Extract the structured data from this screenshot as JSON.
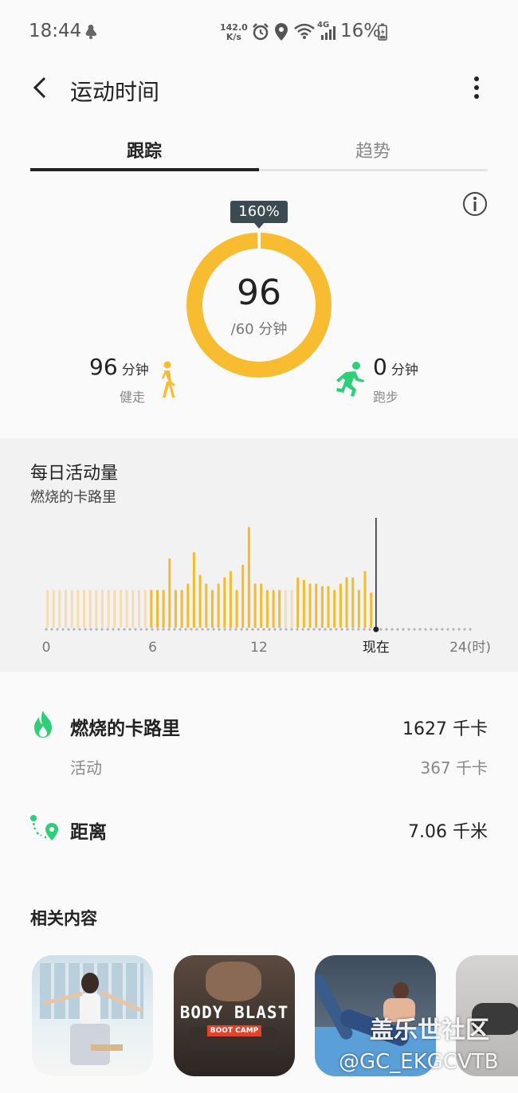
{
  "status_bar": {
    "time": "18:44",
    "net_speed_value": "142.0",
    "net_speed_unit": "K/s",
    "network_type": "4G",
    "battery": "16%"
  },
  "app_bar": {
    "title": "运动时间",
    "back_icon": "back-arrow-icon",
    "menu_icon": "more-vertical-icon"
  },
  "tabs": [
    {
      "label": "跟踪",
      "selected": true
    },
    {
      "label": "趋势",
      "selected": false
    }
  ],
  "summary": {
    "percent": "160%",
    "value": "96",
    "goal": "/60 分钟",
    "progress_fraction": 1.6,
    "walk": {
      "value": "96",
      "unit": "分钟",
      "label": "健走"
    },
    "run": {
      "value": "0",
      "unit": "分钟",
      "label": "跑步"
    },
    "colors": {
      "ring": "#f7bc2f",
      "run": "#2fcf7a"
    }
  },
  "daily": {
    "title": "每日活动量",
    "subtitle": "燃烧的卡路里",
    "chart_data": {
      "type": "bar",
      "x_ticks": [
        "0",
        "6",
        "12",
        "现在",
        "24(时)"
      ],
      "now_hour": 18.6,
      "x_range": [
        0,
        24
      ],
      "active_color": "#f2bc2e",
      "inactive_color": "#f6dcaf",
      "values": [
        30,
        30,
        30,
        30,
        30,
        30,
        30,
        30,
        30,
        30,
        30,
        30,
        30,
        30,
        30,
        30,
        30,
        30,
        30,
        30,
        55,
        30,
        30,
        35,
        60,
        42,
        35,
        30,
        35,
        40,
        45,
        30,
        50,
        80,
        35,
        35,
        30,
        30,
        30,
        30,
        30,
        40,
        38,
        35,
        35,
        33,
        33,
        30,
        35,
        40,
        40,
        30,
        45,
        28
      ]
    }
  },
  "stats": {
    "calories": {
      "label": "燃烧的卡路里",
      "value": "1627 千卡",
      "icon": "flame-icon"
    },
    "active": {
      "label": "活动",
      "value": "367 千卡"
    },
    "distance": {
      "label": "距离",
      "value": "7.06 千米",
      "icon": "route-icon"
    }
  },
  "related": {
    "title": "相关内容",
    "thumbs": [
      {
        "name": "yoga-woman-thumb"
      },
      {
        "name": "body-blast-thumb",
        "title": "BODY BLAST",
        "tag": "BOOT CAMP"
      },
      {
        "name": "pilates-woman-thumb"
      },
      {
        "name": "partial-thumb"
      }
    ],
    "watermark": "盖乐世社区",
    "watermark_handle": "@GC_EKGCVTB"
  }
}
